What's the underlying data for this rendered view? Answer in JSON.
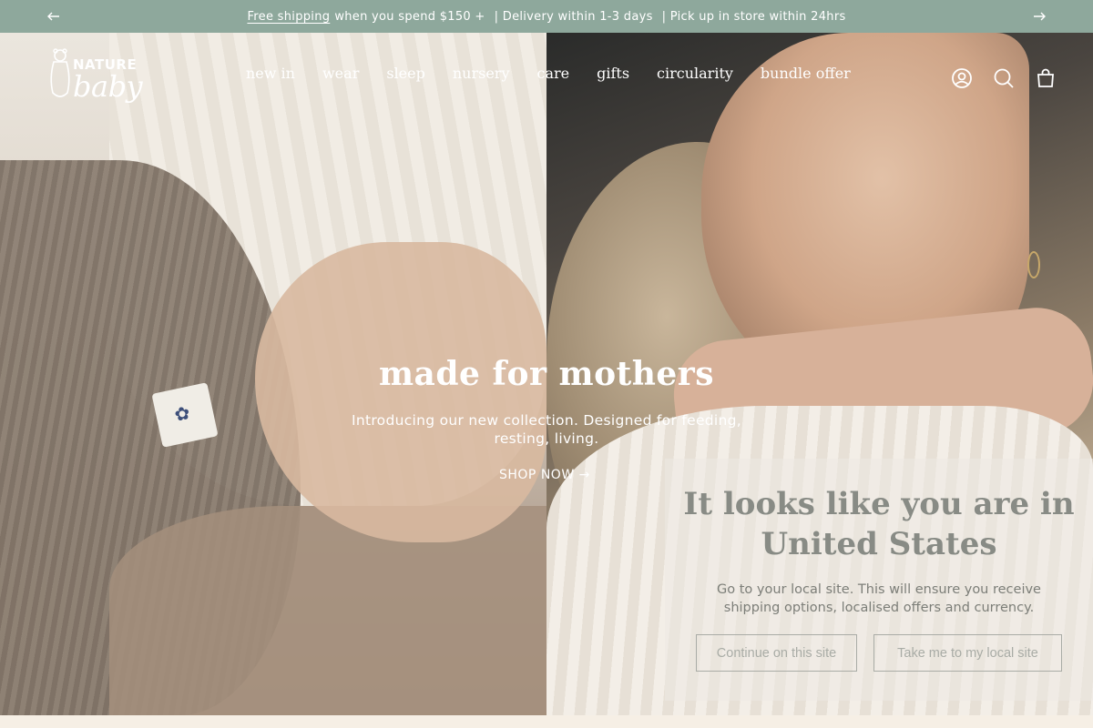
{
  "announcement": {
    "link_text": "Free shipping",
    "text1": "when you spend $150 +",
    "text2": "| Delivery within 1-3 days",
    "text3": "| Pick up in store within 24hrs",
    "prev_icon": "arrow-left-icon",
    "next_icon": "arrow-right-icon"
  },
  "logo": {
    "line1": "NATURE",
    "line2": "baby"
  },
  "nav": {
    "items": [
      "new in",
      "wear",
      "sleep",
      "nursery",
      "care",
      "gifts",
      "circularity",
      "bundle offer"
    ]
  },
  "header_icons": [
    "account-icon",
    "search-icon",
    "cart-icon"
  ],
  "hero": {
    "title": "made for mothers",
    "subtitle": "Introducing our new collection. Designed for feeding, resting, living.",
    "cta": "SHOP NOW →"
  },
  "locale_popup": {
    "title": "It looks like you are in United States",
    "text": "Go to your local site. This will ensure you receive shipping options, localised offers and currency.",
    "button_stay": "Continue on this site",
    "button_go": "Take me to my local site"
  },
  "colors": {
    "announcement_bg": "#8ea89c",
    "page_bg": "#f6efe5"
  }
}
